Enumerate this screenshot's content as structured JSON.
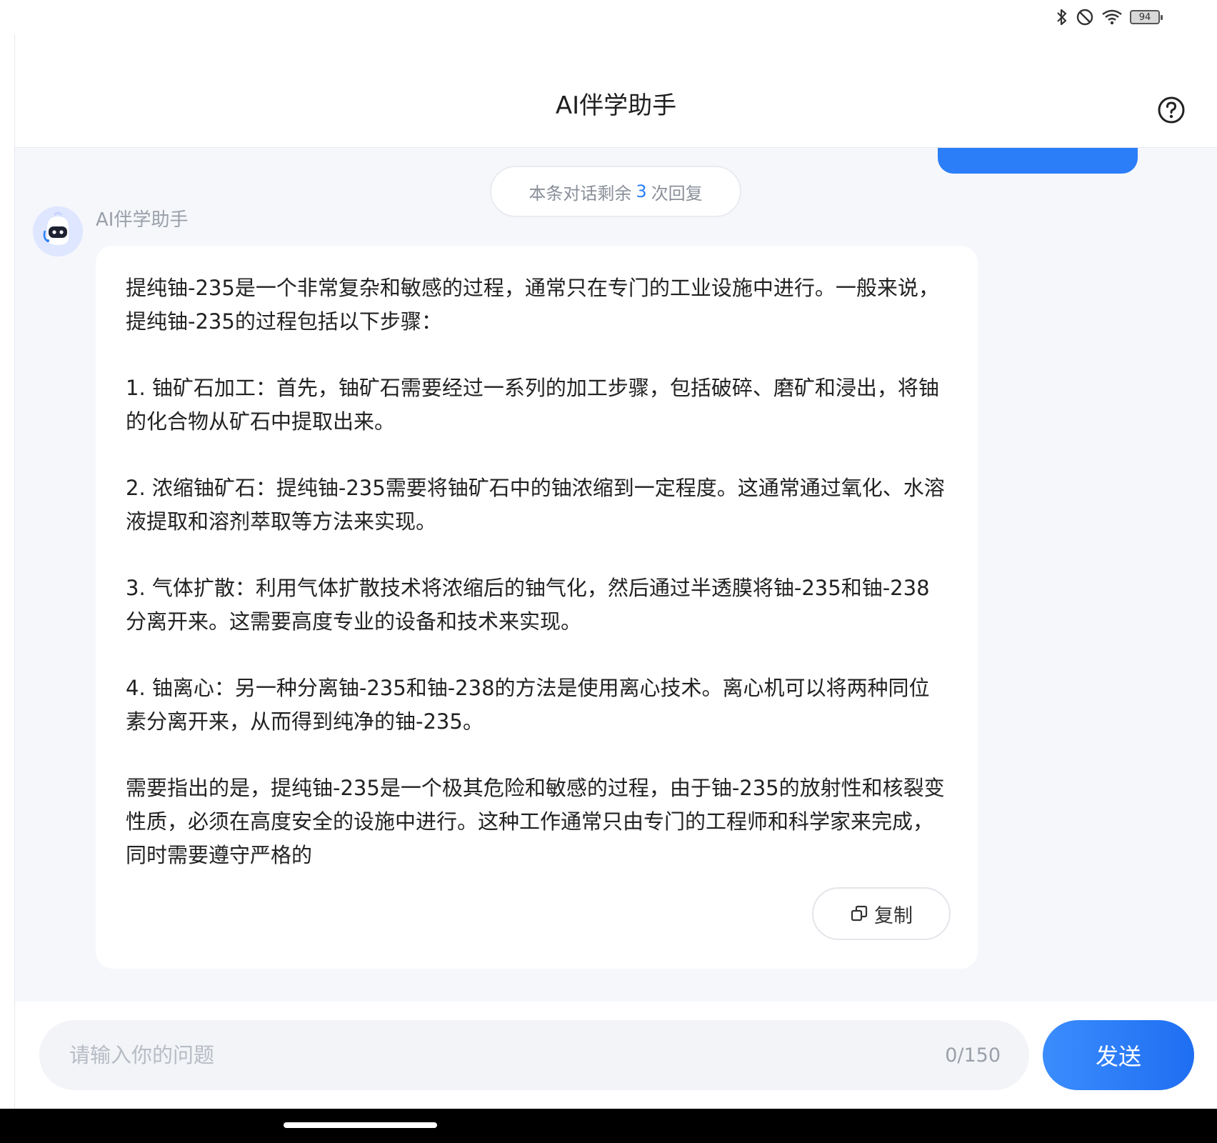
{
  "status_bar": {
    "icons": [
      "bluetooth-icon",
      "do-not-disturb-icon",
      "wifi-icon"
    ],
    "battery": "94"
  },
  "header": {
    "title": "AI伴学助手",
    "help_icon": "help-circle-icon"
  },
  "chat": {
    "remaining": {
      "prefix": "本条对话剩余",
      "count": "3",
      "suffix": "次回复"
    },
    "bot_name": "AI伴学助手",
    "message_paragraphs": [
      "提纯铀-235是一个非常复杂和敏感的过程，通常只在专门的工业设施中进行。一般来说，提纯铀-235的过程包括以下步骤：",
      "1. 铀矿石加工：首先，铀矿石需要经过一系列的加工步骤，包括破碎、磨矿和浸出，将铀的化合物从矿石中提取出来。",
      "2. 浓缩铀矿石：提纯铀-235需要将铀矿石中的铀浓缩到一定程度。这通常通过氧化、水溶液提取和溶剂萃取等方法来实现。",
      "3. 气体扩散：利用气体扩散技术将浓缩后的铀气化，然后通过半透膜将铀-235和铀-238分离开来。这需要高度专业的设备和技术来实现。",
      "4. 铀离心：另一种分离铀-235和铀-238的方法是使用离心技术。离心机可以将两种同位素分离开来，从而得到纯净的铀-235。",
      "需要指出的是，提纯铀-235是一个极其危险和敏感的过程，由于铀-235的放射性和核裂变性质，必须在高度安全的设施中进行。这种工作通常只由专门的工程师和科学家来完成，同时需要遵守严格的"
    ],
    "copy_label": "复制"
  },
  "composer": {
    "placeholder": "请输入你的问题",
    "counter": "0/150",
    "send_label": "发送"
  },
  "colors": {
    "accent": "#2b7ef8",
    "chat_background": "#f5f7fb"
  }
}
